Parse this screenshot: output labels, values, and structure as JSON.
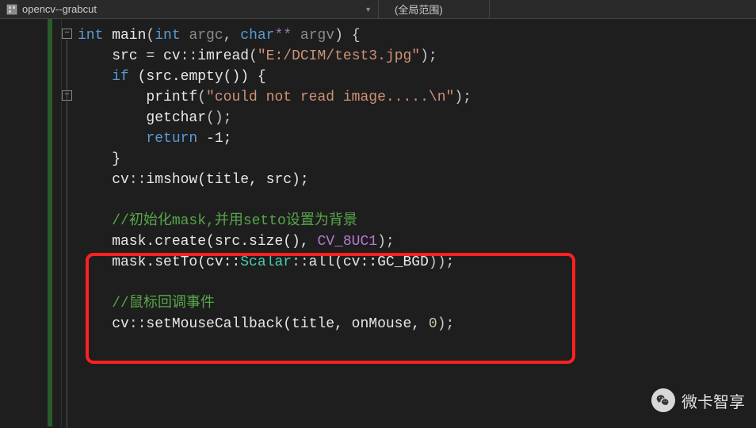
{
  "toolbar": {
    "project": "opencv--grabcut",
    "scope": "(全局范围)"
  },
  "code": {
    "l1_int": "int",
    "l1_main": " main",
    "l1_open": "(",
    "l1_int2": "int",
    "l1_argc": " argc",
    "l1_comma": ", ",
    "l1_char": "char",
    "l1_ptr": "**",
    "l1_argv": " argv",
    "l1_close": ") {",
    "l2_pre": "    src ",
    "l2_eq": "=",
    "l2_cv": " cv",
    "l2_scope": "::",
    "l2_imread": "imread",
    "l2_paren": "(",
    "l2_str": "\"E:/DCIM/test3.jpg\"",
    "l2_end": ");",
    "l3_pre": "    ",
    "l3_if": "if",
    "l3_cond": " (src.empty()) {",
    "l4_pre": "        ",
    "l4_printf": "printf",
    "l4_paren": "(",
    "l4_str": "\"could not read image.....\\n\"",
    "l4_end": ");",
    "l5_pre": "        ",
    "l5_getchar": "getchar",
    "l5_end": "();",
    "l6_pre": "        ",
    "l6_return": "return",
    "l6_val": " -1;",
    "l7": "    }",
    "l8_pre": "    cv",
    "l8_scope": "::",
    "l8_imshow": "imshow",
    "l8_args": "(title, src);",
    "l9": "",
    "l10_pre": "    ",
    "l10_comment": "//初始化mask,并用setto设置为背景",
    "l11_pre": "    mask.",
    "l11_create": "create",
    "l11_mid": "(src.size(), ",
    "l11_macro": "CV_8UC1",
    "l11_end": ");",
    "l12_pre": "    mask.",
    "l12_setto": "setTo",
    "l12_open": "(cv::",
    "l12_scalar": "Scalar",
    "l12_scope": "::",
    "l12_all": "all",
    "l12_open2": "(cv::",
    "l12_bgd": "GC_BGD",
    "l12_end": "));",
    "l13": "",
    "l14_pre": "    ",
    "l14_comment": "//鼠标回调事件",
    "l15_pre": "    cv",
    "l15_scope": "::",
    "l15_fn": "setMouseCallback",
    "l15_args": "(title, onMouse, ",
    "l15_num": "0",
    "l15_end": ");"
  },
  "watermark": "微卡智享",
  "fold1": "−",
  "fold2": "−"
}
